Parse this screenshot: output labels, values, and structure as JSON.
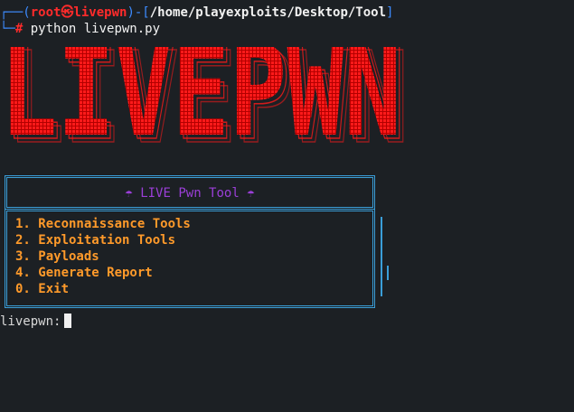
{
  "prompt": {
    "corner_top": "┌──(",
    "user_host": "root㉿livepwn",
    "close_paren": ")-[",
    "path": "/home/playexploits/Desktop/Tool",
    "close_bracket": "]",
    "corner_bottom": "└─",
    "symbol": "#",
    "command": " python livepwn.py"
  },
  "banner": {
    "text": "LIVEPWN",
    "color": "#ff1a1a"
  },
  "menu": {
    "title": "☂ LIVE Pwn Tool ☂",
    "items": [
      "1. Reconnaissance Tools",
      "2. Exploitation Tools",
      "3. Payloads",
      "4. Generate Report",
      "0. Exit"
    ]
  },
  "input": {
    "prompt": "livepwn:"
  },
  "colors": {
    "background": "#1c2024",
    "prompt_blue": "#3d8bff",
    "prompt_red": "#ff2b2b",
    "frame": "#3a9ed8",
    "title": "#9b3fd8",
    "menu_text": "#ff9a2a"
  }
}
